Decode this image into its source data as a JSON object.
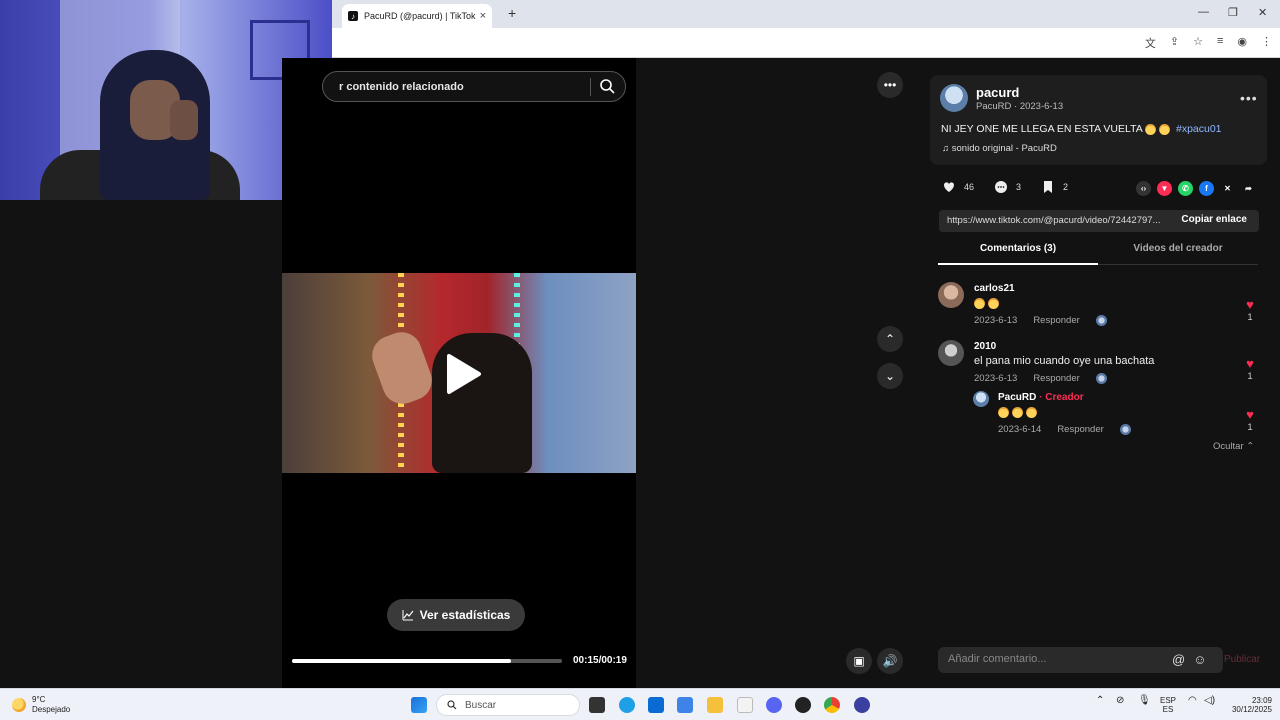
{
  "browser": {
    "tab_title": "PacuRD (@pacurd) | TikTok",
    "tab_close": "×",
    "new_tab": "+"
  },
  "video": {
    "search_placeholder": "r contenido relacionado",
    "stats_label": "Ver estadísticas",
    "time": "00:15/00:19",
    "progress": 0.81
  },
  "author": {
    "username": "pacurd",
    "subline": "PacuRD · 2023-6-13",
    "caption": "NI JEY ONE ME LLEGA EN ESTA VUELTA",
    "hashtag": "#xpacu01",
    "sound": "sonido original - PacuRD"
  },
  "stats": {
    "likes": "46",
    "comments": "3",
    "saves": "2"
  },
  "link": {
    "url": "https://www.tiktok.com/@pacurd/video/72442797...",
    "copy_label": "Copiar enlace"
  },
  "tabs": {
    "comments": "Comentarios (3)",
    "videos": "Videos del creador"
  },
  "comments": [
    {
      "name": "carlos21",
      "text": "",
      "date": "2023-6-13",
      "reply": "Responder",
      "likes": "1"
    },
    {
      "name": "2010",
      "text": "el pana mio cuando oye una bachata",
      "date": "2023-6-13",
      "reply": "Responder",
      "likes": "1"
    }
  ],
  "reply": {
    "name": "PacuRD",
    "creator_tag": "· Creador",
    "date": "2023-6-14",
    "reply": "Responder",
    "likes": "1"
  },
  "hide_label": "Ocultar",
  "comment_input": {
    "placeholder": "Añadir comentario...",
    "post": "Publicar"
  },
  "taskbar": {
    "temp": "9°C",
    "weather": "Despejado",
    "search": "Buscar",
    "lang1": "ESP",
    "lang2": "ES",
    "time": "23:09",
    "date": "30/12/2025"
  }
}
